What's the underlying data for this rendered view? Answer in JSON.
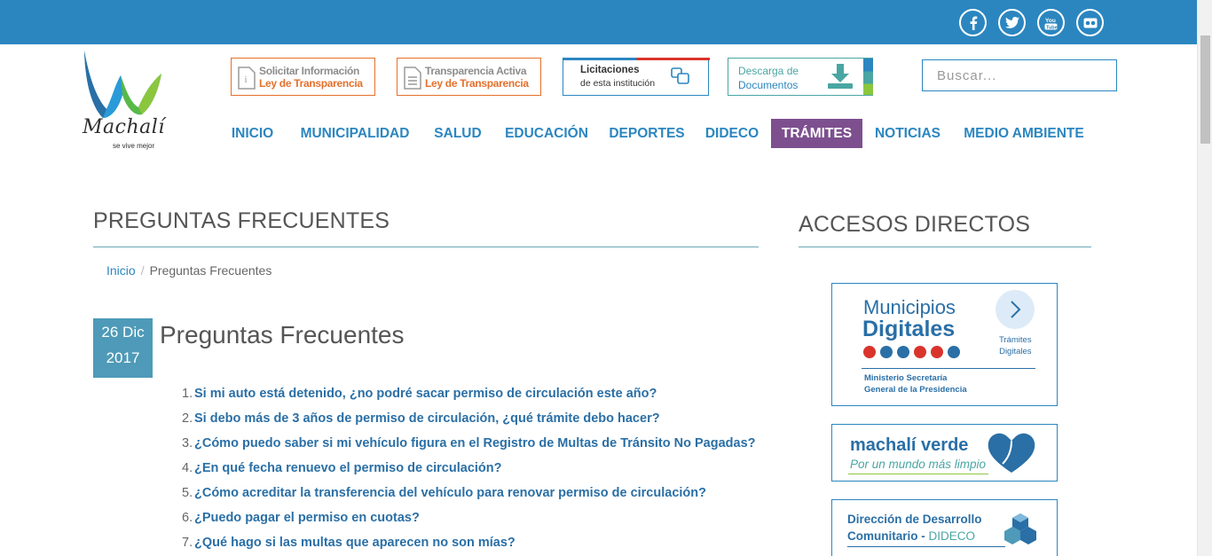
{
  "social": [
    {
      "name": "facebook"
    },
    {
      "name": "twitter"
    },
    {
      "name": "youtube",
      "label": "You"
    },
    {
      "name": "flickr"
    }
  ],
  "logo": {
    "word": "Machalí",
    "tagline": "se vive mejor"
  },
  "header_buttons": {
    "solicitar": {
      "line1": "Solicitar Información",
      "line2": "Ley de Transparencia"
    },
    "transparencia": {
      "line1": "Transparencia Activa",
      "line2": "Ley de Transparencia"
    },
    "licitaciones": {
      "line1": "Licitaciones",
      "line2": "de esta institución"
    },
    "descarga": {
      "line1": "Descarga de",
      "line2": "Documentos"
    }
  },
  "search": {
    "placeholder": "Buscar..."
  },
  "nav": [
    {
      "label": "INICIO"
    },
    {
      "label": "MUNICIPALIDAD"
    },
    {
      "label": "SALUD"
    },
    {
      "label": "EDUCACIÓN"
    },
    {
      "label": "DEPORTES"
    },
    {
      "label": "DIDECO"
    },
    {
      "label": "TRÁMITES",
      "active": true
    },
    {
      "label": "NOTICIAS"
    },
    {
      "label": "MEDIO AMBIENTE"
    }
  ],
  "main": {
    "section_title": "PREGUNTAS FRECUENTES",
    "breadcrumb": {
      "home": "Inicio",
      "separator": "/",
      "current": "Preguntas Frecuentes"
    },
    "date": {
      "day_month": "26 Dic",
      "year": "2017"
    },
    "post_title": "Preguntas Frecuentes",
    "faq": [
      {
        "num": "1.",
        "q": "Si mi auto está detenido, ¿no podré sacar permiso de circulación este año?"
      },
      {
        "num": "2.",
        "q": "Si debo más de 3 años de permiso de circulación, ¿qué trámite debo hacer?"
      },
      {
        "num": "3.",
        "q": "¿Cómo puedo saber si mi vehículo figura en el Registro de Multas de Tránsito No Pagadas?"
      },
      {
        "num": "4.",
        "q": "¿En qué fecha renuevo el permiso de circulación?"
      },
      {
        "num": "5.",
        "q": "¿Cómo acreditar la transferencia del vehículo para renovar permiso de circulación?"
      },
      {
        "num": "6.",
        "q": "¿Puedo pagar el permiso en cuotas?"
      },
      {
        "num": "7.",
        "q": "¿Qué hago si las multas que aparecen no son mías?"
      }
    ]
  },
  "sidebar": {
    "title": "ACCESOS DIRECTOS",
    "municipios": {
      "line1": "Municipios",
      "line2": "Digitales",
      "tramites1": "Trámites",
      "tramites2": "Digitales",
      "ministerio1": "Ministerio Secretaría",
      "ministerio2": "General de la Presidencia"
    },
    "verde": {
      "title": "machalí verde",
      "subtitle": "Por un mundo más limpio"
    },
    "dideco": {
      "line1": "Dirección de Desarrollo",
      "line2a": "Comunitario - ",
      "line2b": "DIDECO"
    }
  },
  "colors": {
    "primary": "#2b86c0",
    "orange": "#e4702b",
    "active_nav": "#7d4f8f",
    "date_box": "#4e9ab8",
    "link": "#2a6fa6"
  }
}
